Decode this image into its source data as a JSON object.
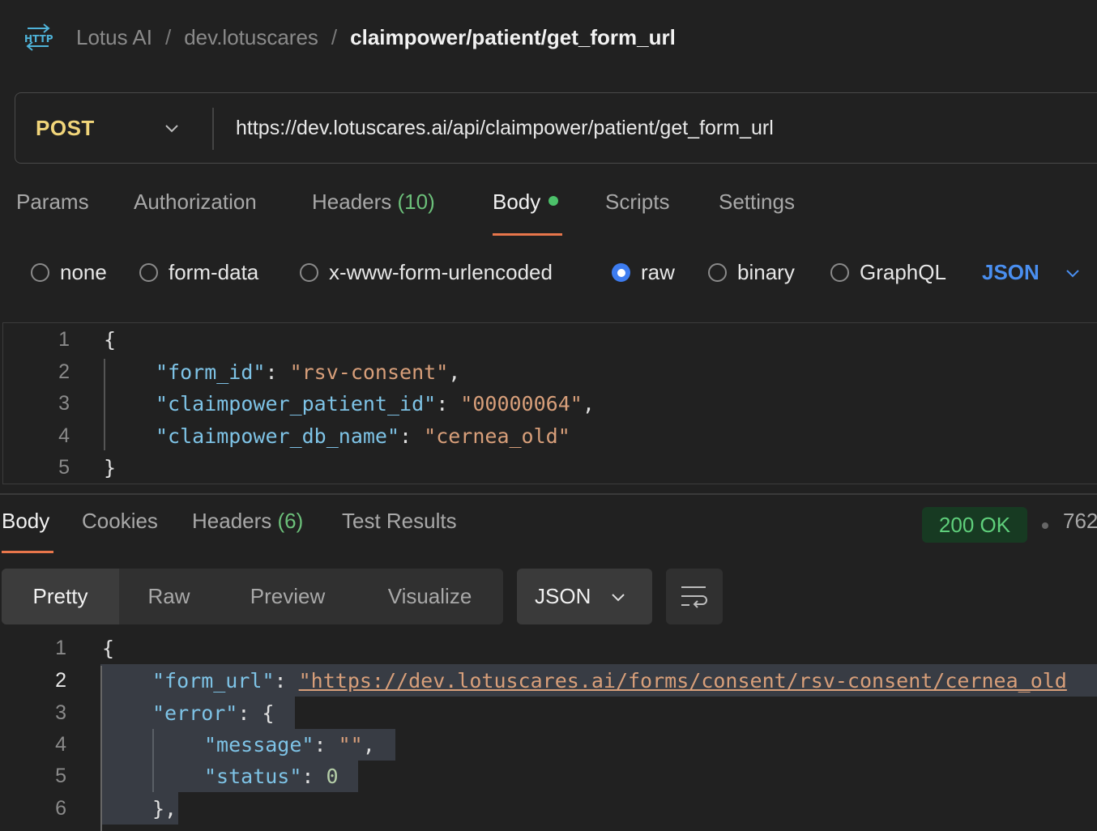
{
  "breadcrumb": {
    "icon": "http-icon",
    "items": [
      "Lotus AI",
      "dev.lotuscares"
    ],
    "separator": "/",
    "current": "claimpower/patient/get_form_url"
  },
  "request": {
    "method": "POST",
    "url": "https://dev.lotuscares.ai/api/claimpower/patient/get_form_url"
  },
  "tabs": {
    "params": "Params",
    "authorization": "Authorization",
    "headers": "Headers",
    "headers_count": "(10)",
    "body": "Body",
    "scripts": "Scripts",
    "settings": "Settings"
  },
  "body_types": {
    "none": "none",
    "form_data": "form-data",
    "urlencoded": "x-www-form-urlencoded",
    "raw": "raw",
    "binary": "binary",
    "graphql": "GraphQL",
    "selected": "raw",
    "language": "JSON"
  },
  "request_body": {
    "line_numbers": [
      "1",
      "2",
      "3",
      "4",
      "5"
    ],
    "open_brace": "{",
    "close_brace": "}",
    "fields": [
      {
        "key": "\"form_id\"",
        "value": "\"rsv-consent\"",
        "trail": ","
      },
      {
        "key": "\"claimpower_patient_id\"",
        "value": "\"00000064\"",
        "trail": ","
      },
      {
        "key": "\"claimpower_db_name\"",
        "value": "\"cernea_old\"",
        "trail": ""
      }
    ]
  },
  "response": {
    "tabs": {
      "body": "Body",
      "cookies": "Cookies",
      "headers": "Headers",
      "headers_count": "(6)",
      "test_results": "Test Results"
    },
    "status": "200 OK",
    "size_partial": "762",
    "views": {
      "pretty": "Pretty",
      "raw": "Raw",
      "preview": "Preview",
      "visualize": "Visualize"
    },
    "format": "JSON",
    "line_numbers": [
      "1",
      "2",
      "3",
      "4",
      "5",
      "6"
    ],
    "lines": {
      "l1": "{",
      "form_url_key": "\"form_url\"",
      "form_url_value": "\"https://dev.lotuscares.ai/forms/consent/rsv-consent/cernea_old",
      "error_key": "\"error\"",
      "error_open": "{",
      "message_key": "\"message\"",
      "message_value": "\"\"",
      "status_key": "\"status\"",
      "status_value": "0",
      "error_close": "},"
    }
  },
  "colors": {
    "background": "#212121",
    "method": "#f1d57a",
    "accent_tab": "#e8764b",
    "status_ok": "#5fcf7b",
    "radio_selected": "#3d7cf0",
    "json_key": "#7ec3e6",
    "json_string": "#d89f7a"
  }
}
